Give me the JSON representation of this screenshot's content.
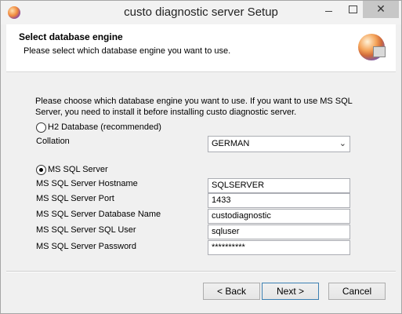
{
  "window": {
    "title": "custo diagnostic server Setup"
  },
  "header": {
    "title": "Select database engine",
    "subtitle": "Please select which database engine you want to use."
  },
  "intro": "Please choose which database engine you want to use. If you want to use MS SQL Server, you need to install it before installing custo diagnostic server.",
  "h2": {
    "label": "H2 Database (recommended)",
    "selected": false
  },
  "collation": {
    "label": "Collation",
    "value": "GERMAN"
  },
  "mssql": {
    "label": "MS SQL Server",
    "selected": true,
    "fields": [
      {
        "label": "MS SQL Server Hostname",
        "value": "SQLSERVER"
      },
      {
        "label": "MS SQL Server Port",
        "value": "1433"
      },
      {
        "label": "MS SQL Server Database Name",
        "value": "custodiagnostic"
      },
      {
        "label": "MS SQL Server SQL User",
        "value": "sqluser"
      },
      {
        "label": "MS SQL Server Password",
        "value": "**********"
      }
    ]
  },
  "buttons": {
    "back": "< Back",
    "next": "Next >",
    "cancel": "Cancel"
  },
  "icons": {
    "app": "app-logo-icon",
    "minimize": "minimize-icon",
    "maximize": "maximize-icon",
    "close": "close-icon",
    "dropdown": "chevron-down-icon"
  }
}
